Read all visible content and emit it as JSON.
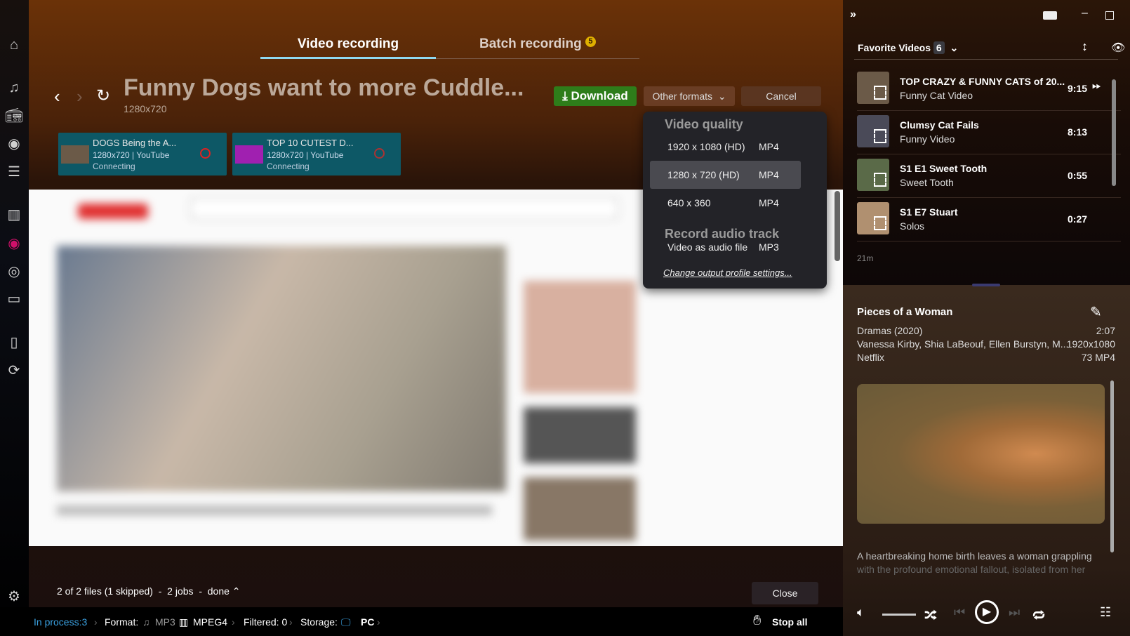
{
  "tabs": [
    {
      "label": "Video recording",
      "active": true
    },
    {
      "label": "Batch recording",
      "badge": "5"
    }
  ],
  "video": {
    "title": "Funny Dogs want to more Cuddle...",
    "resolution": "1280x720"
  },
  "actions": {
    "download": "Download",
    "other_formats": "Other formats",
    "cancel": "Cancel"
  },
  "jobs": [
    {
      "title": "DOGS Being the A...",
      "meta": "1280x720 | YouTube",
      "status": "Connecting"
    },
    {
      "title": "TOP 10 CUTEST D...",
      "meta": "1280x720 | YouTube",
      "status": "Connecting"
    }
  ],
  "dropdown": {
    "video_heading": "Video quality",
    "items": [
      {
        "res": "1920 x 1080 (HD)",
        "fmt": "MP4"
      },
      {
        "res": "1280 x 720 (HD)",
        "fmt": "MP4",
        "selected": true
      },
      {
        "res": "640 x 360",
        "fmt": "MP4"
      }
    ],
    "audio_heading": "Record audio track",
    "audio_item": {
      "res": "Video as audio file",
      "fmt": "MP3"
    },
    "link": "Change output profile settings..."
  },
  "bottom": {
    "summary": "2 of 2 files (1 skipped)  -  2 jobs  -  done",
    "close": "Close"
  },
  "statusbar": {
    "in_process": "In process:3",
    "format_label": "Format:",
    "format_audio": "MP3",
    "format_video": "MPEG4",
    "filtered": "Filtered: 0",
    "storage_label": "Storage:",
    "storage": "PC",
    "stop_all": "Stop all"
  },
  "playlist": {
    "title": "Favorite Videos",
    "count": "6",
    "items": [
      {
        "title": "TOP CRAZY & FUNNY CATS of 20...",
        "subtitle": "Funny Cat Video",
        "time": "9:15"
      },
      {
        "title": "Clumsy Cat Fails",
        "subtitle": "Funny Video",
        "time": "8:13"
      },
      {
        "title": "S1 E1 Sweet Tooth",
        "subtitle": "Sweet Tooth",
        "time": "0:55"
      },
      {
        "title": "S1 E7 Stuart",
        "subtitle": "Solos",
        "time": "0:27"
      }
    ],
    "total": "21m"
  },
  "details": {
    "title": "Pieces of a Woman",
    "genre": "Dramas (2020)",
    "duration": "2:07",
    "cast": "Vanessa Kirby, Shia LaBeouf, Ellen Burstyn, M...",
    "resolution": "1920x1080",
    "source": "Netflix",
    "format": "73 MP4",
    "description_1": "A heartbreaking home birth leaves a woman grappling",
    "description_2": "with the profound emotional fallout, isolated from her"
  },
  "colors": {
    "accent": "#8fd8f0",
    "download": "#2e7d1a",
    "job_card": "#0d5866",
    "badge": "#e0b000",
    "link": "#3aa0e0"
  }
}
